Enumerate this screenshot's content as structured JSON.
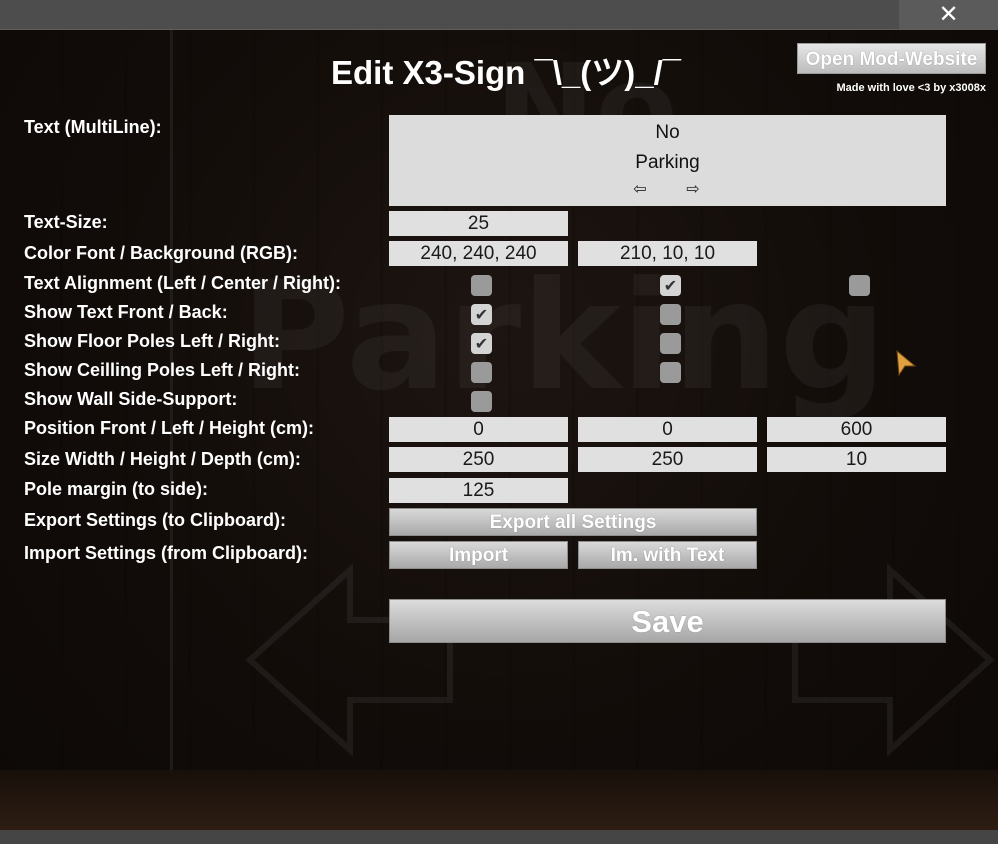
{
  "window": {
    "close_icon": "✕"
  },
  "header": {
    "title": "Edit X3-Sign ¯\\_(ツ)_/¯",
    "mod_website_label": "Open Mod-Website",
    "made_with": "Made with love <3 by x3008x"
  },
  "background": {
    "ghost_line1": "No",
    "ghost_line2": "Parking"
  },
  "form": {
    "text_label": "Text (MultiLine):",
    "text_value_line1": "No",
    "text_value_line2": "Parking",
    "arrow_left_icon": "⇦",
    "arrow_right_icon": "⇨",
    "text_size_label": "Text-Size:",
    "text_size_value": "25",
    "color_label": "Color Font / Background (RGB):",
    "color_font_value": "240, 240, 240",
    "color_bg_value": "210, 10, 10",
    "alignment_label": "Text Alignment (Left / Center / Right):",
    "alignment": {
      "left": false,
      "center": true,
      "right": false
    },
    "show_text_label": "Show Text Front / Back:",
    "show_text": {
      "front": true,
      "back": false
    },
    "floor_poles_label": "Show Floor Poles Left / Right:",
    "floor_poles": {
      "left": true,
      "right": false
    },
    "ceiling_poles_label": "Show Ceilling Poles Left / Right:",
    "ceiling_poles": {
      "left": false,
      "right": false
    },
    "wall_support_label": "Show Wall Side-Support:",
    "wall_support": false,
    "position_label": "Position Front / Left / Height (cm):",
    "position_front": "0",
    "position_left": "0",
    "position_height": "600",
    "size_label": "Size Width / Height / Depth (cm):",
    "size_width": "250",
    "size_height": "250",
    "size_depth": "10",
    "pole_margin_label": "Pole margin (to side):",
    "pole_margin_value": "125",
    "export_label": "Export Settings (to Clipboard):",
    "export_button": "Export all Settings",
    "import_label": "Import Settings (from Clipboard):",
    "import_button": "Import",
    "import_with_text_button": "Im. with Text",
    "save_button": "Save",
    "check_mark": "✔"
  },
  "colors": {
    "panel_bg": "#000000",
    "field_bg": "#e0e0e0",
    "checkbox_unchecked": "#9a9a9a",
    "checkbox_checked": "#d4d4d4",
    "cursor": "#e0a040"
  }
}
